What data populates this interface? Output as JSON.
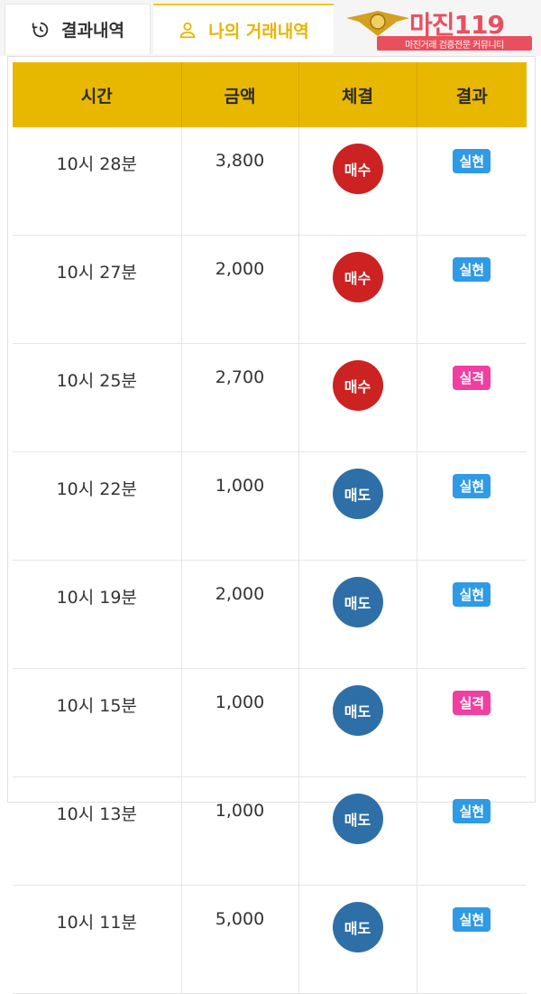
{
  "tabs": [
    {
      "label": "결과내역"
    },
    {
      "label": "나의 거래내역"
    }
  ],
  "logo": {
    "text": "마진119",
    "subtitle": "마진거래 검증전문 커뮤니티"
  },
  "colors": {
    "header_bg": "#e8b800",
    "buy": "#cc2222",
    "sell": "#2e6fa8",
    "win": "#2f9ae6",
    "lose": "#f03fa0",
    "active_tab": "#e8b500"
  },
  "table": {
    "headers": [
      "시간",
      "금액",
      "체결",
      "결과"
    ],
    "rows": [
      {
        "time": "10시 28분",
        "amount": "3,800",
        "trade": "매수",
        "trade_type": "buy",
        "result": "실현",
        "result_type": "win"
      },
      {
        "time": "10시 27분",
        "amount": "2,000",
        "trade": "매수",
        "trade_type": "buy",
        "result": "실현",
        "result_type": "win"
      },
      {
        "time": "10시 25분",
        "amount": "2,700",
        "trade": "매수",
        "trade_type": "buy",
        "result": "실격",
        "result_type": "lose"
      },
      {
        "time": "10시 22분",
        "amount": "1,000",
        "trade": "매도",
        "trade_type": "sell",
        "result": "실현",
        "result_type": "win"
      },
      {
        "time": "10시 19분",
        "amount": "2,000",
        "trade": "매도",
        "trade_type": "sell",
        "result": "실현",
        "result_type": "win"
      },
      {
        "time": "10시 15분",
        "amount": "1,000",
        "trade": "매도",
        "trade_type": "sell",
        "result": "실격",
        "result_type": "lose"
      },
      {
        "time": "10시 13분",
        "amount": "1,000",
        "trade": "매도",
        "trade_type": "sell",
        "result": "실현",
        "result_type": "win"
      },
      {
        "time": "10시 11분",
        "amount": "5,000",
        "trade": "매도",
        "trade_type": "sell",
        "result": "실현",
        "result_type": "win"
      }
    ]
  }
}
